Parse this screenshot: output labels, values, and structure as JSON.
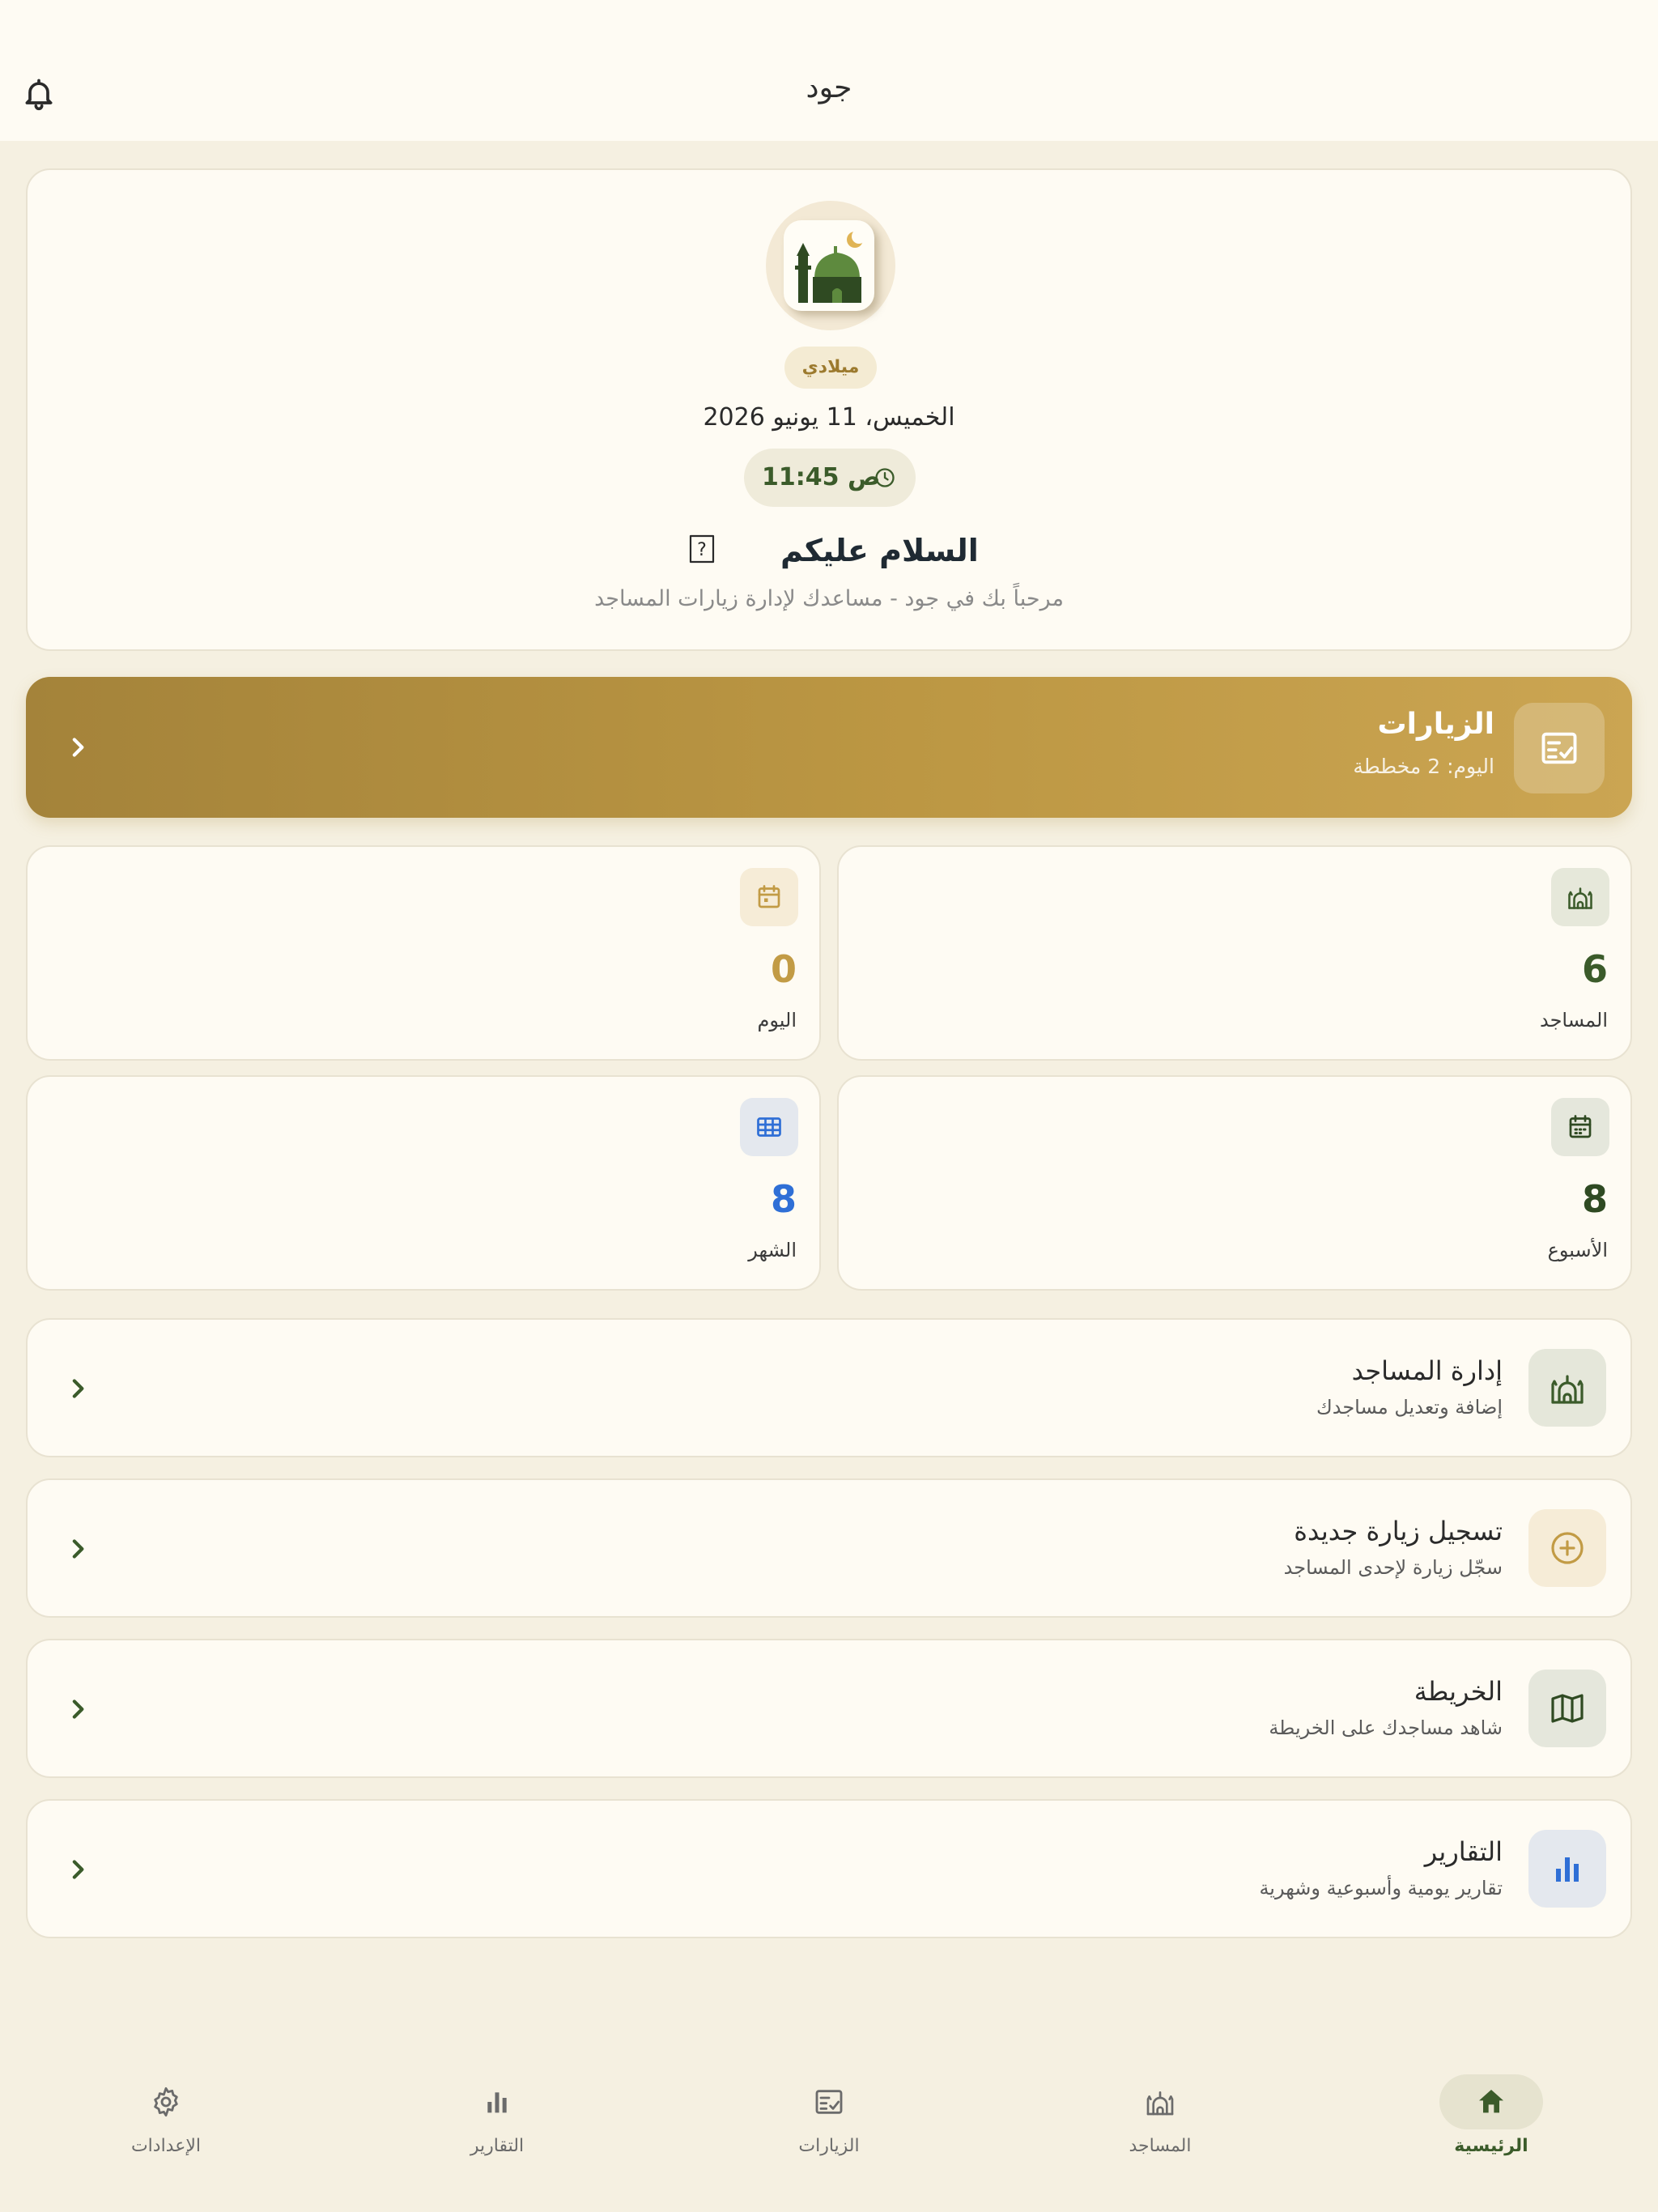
{
  "app": {
    "title": "جود"
  },
  "hero": {
    "calendar_badge": "ميلادي",
    "date": "الخميس، 11 يونيو 2026",
    "time": "11:45 ص",
    "greeting": "السلام عليكم",
    "welcome": "مرحباً بك في جود - مساعدك لإدارة زيارات المساجد"
  },
  "visits_banner": {
    "title": "الزيارات",
    "subtitle": "اليوم: 2 مخططة"
  },
  "stats": [
    {
      "label": "المساجد",
      "value": "6",
      "color": "#3B5B2A",
      "icon": "mosque-icon"
    },
    {
      "label": "اليوم",
      "value": "0",
      "color": "#C29B45",
      "icon": "calendar-today-icon"
    },
    {
      "label": "الأسبوع",
      "value": "8",
      "color": "#2F4A22",
      "icon": "calendar-week-icon"
    },
    {
      "label": "الشهر",
      "value": "8",
      "color": "#2F6FD6",
      "icon": "grid-icon"
    }
  ],
  "menu": [
    {
      "title": "إدارة المساجد",
      "subtitle": "إضافة وتعديل مساجدك",
      "icon": "mosque-icon"
    },
    {
      "title": "تسجيل زيارة جديدة",
      "subtitle": "سجّل زيارة لإحدى المساجد",
      "icon": "add-circle-icon"
    },
    {
      "title": "الخريطة",
      "subtitle": "شاهد مساجدك على الخريطة",
      "icon": "map-icon"
    },
    {
      "title": "التقارير",
      "subtitle": "تقارير يومية وأسبوعية وشهرية",
      "icon": "bar-chart-icon"
    }
  ],
  "bottom_nav": [
    {
      "label": "الرئيسية",
      "icon": "home-icon",
      "active": true
    },
    {
      "label": "المساجد",
      "icon": "mosque-icon",
      "active": false
    },
    {
      "label": "الزيارات",
      "icon": "checklist-icon",
      "active": false
    },
    {
      "label": "التقارير",
      "icon": "bar-chart-icon",
      "active": false
    },
    {
      "label": "الإعدادات",
      "icon": "gear-icon",
      "active": false
    }
  ],
  "colors": {
    "background": "#F5F0E1",
    "surface": "#FEFBF3",
    "primary_green": "#3B5B2A",
    "gold": "#C29B45",
    "blue": "#2F6FD6"
  }
}
